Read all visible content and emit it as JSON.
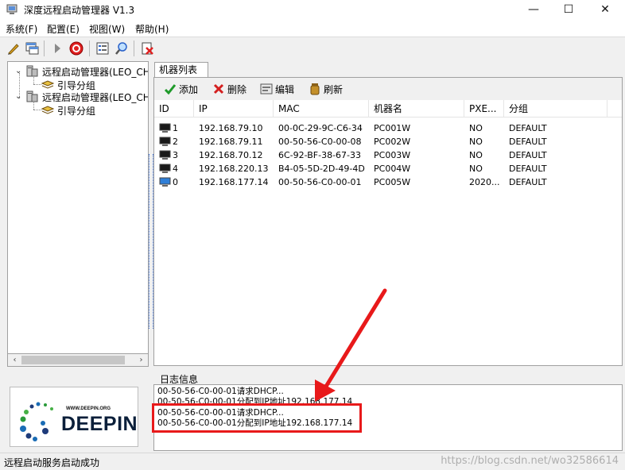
{
  "window": {
    "title": "深度远程启动管理器 V1.3",
    "minimize_glyph": "—",
    "maximize_glyph": "☐",
    "close_glyph": "✕"
  },
  "menu": [
    "系统(F)",
    "配置(E)",
    "视图(W)",
    "帮助(H)"
  ],
  "toolbar_icons": [
    "pencil-icon",
    "window-icon",
    "play-icon",
    "stop-icon",
    "settings-list-icon",
    "search-icon",
    "exit-icon"
  ],
  "tree": {
    "servers": [
      {
        "label": "远程启动管理器(LEO_CHE",
        "child": "引导分组"
      },
      {
        "label": "远程启动管理器(LEO_CHE",
        "child": "引导分组"
      }
    ]
  },
  "tab": {
    "label": "机器列表"
  },
  "actions": {
    "add": "添加",
    "delete": "删除",
    "edit": "编辑",
    "refresh": "刷新"
  },
  "columns": [
    "ID",
    "IP",
    "MAC",
    "机器名",
    "PXE...",
    "分组"
  ],
  "machines": [
    {
      "id": "1",
      "ip": "192.168.79.10",
      "mac": "00-0C-29-9C-C6-34",
      "name": "PC001W",
      "pxe": "NO",
      "group": "DEFAULT",
      "online": false
    },
    {
      "id": "2",
      "ip": "192.168.79.11",
      "mac": "00-50-56-C0-00-08",
      "name": "PC002W",
      "pxe": "NO",
      "group": "DEFAULT",
      "online": false
    },
    {
      "id": "3",
      "ip": "192.168.70.12",
      "mac": "6C-92-BF-38-67-33",
      "name": "PC003W",
      "pxe": "NO",
      "group": "DEFAULT",
      "online": false
    },
    {
      "id": "4",
      "ip": "192.168.220.13",
      "mac": "B4-05-5D-2D-49-4D",
      "name": "PC004W",
      "pxe": "NO",
      "group": "DEFAULT",
      "online": false
    },
    {
      "id": "0",
      "ip": "192.168.177.14",
      "mac": "00-50-56-C0-00-01",
      "name": "PC005W",
      "pxe": "2020...",
      "group": "DEFAULT",
      "online": true
    }
  ],
  "log": {
    "label": "日志信息",
    "lines": [
      "00-50-56-C0-00-01请求DHCP...",
      "00-50-56-C0-00-01分配到IP地址192.168.177.14",
      "00-50-56-C0-00-01请求DHCP...",
      "00-50-56-C0-00-01分配到IP地址192.168.177.14"
    ]
  },
  "logo": {
    "url_text": "WWW.DEEPIN.ORG",
    "brand": "DEEPIN"
  },
  "status": {
    "text": "远程启动服务启动成功"
  },
  "watermark": "https://blog.csdn.net/wo32586614",
  "colors": {
    "highlight": "#e8191a",
    "accent_blue": "#1f5bb5"
  }
}
